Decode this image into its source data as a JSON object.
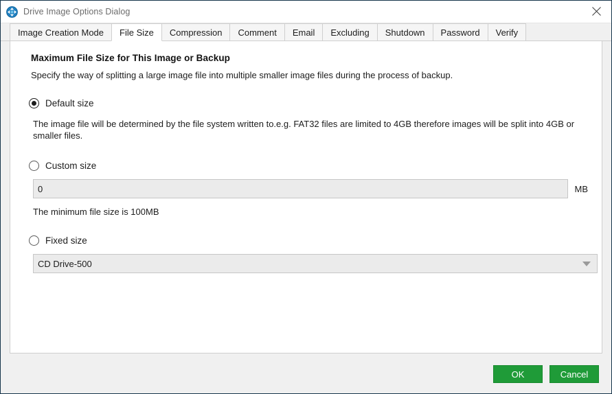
{
  "window": {
    "title": "Drive Image Options Dialog",
    "icon": "drive-sync-icon",
    "close_label": "✕",
    "border_color": "#16344b"
  },
  "tabs": [
    {
      "label": "Image Creation Mode",
      "active": false
    },
    {
      "label": "File Size",
      "active": true
    },
    {
      "label": "Compression",
      "active": false
    },
    {
      "label": "Comment",
      "active": false
    },
    {
      "label": "Email",
      "active": false
    },
    {
      "label": "Excluding",
      "active": false
    },
    {
      "label": "Shutdown",
      "active": false
    },
    {
      "label": "Password",
      "active": false
    },
    {
      "label": "Verify",
      "active": false
    }
  ],
  "content": {
    "heading": "Maximum File Size for This Image or Backup",
    "subheading": "Specify the way of splitting a large image file into multiple smaller image files during the process of backup.",
    "default_size": {
      "label": "Default size",
      "selected": true,
      "description": "The image file will be determined by the file system written to.e.g. FAT32 files are limited to 4GB therefore images will be  split into 4GB or smaller files."
    },
    "custom_size": {
      "label": "Custom size",
      "selected": false,
      "value": "0",
      "placeholder": "0",
      "unit": "MB",
      "hint": "The minimum file size is 100MB"
    },
    "fixed_size": {
      "label": "Fixed size",
      "selected": false,
      "selected_option": "CD Drive-500",
      "dropdown_icon": "chevron-down-icon"
    }
  },
  "footer": {
    "ok_label": "OK",
    "cancel_label": "Cancel",
    "button_color": "#1f9b38"
  }
}
